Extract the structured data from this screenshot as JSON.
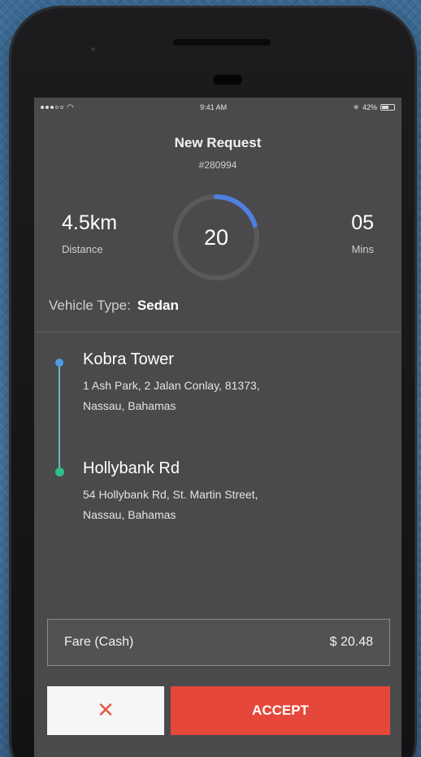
{
  "status_bar": {
    "time": "9:41 AM",
    "battery": "42%"
  },
  "header": {
    "title": "New Request",
    "request_id": "#280994"
  },
  "stats": {
    "distance_value": "4.5km",
    "distance_label": "Distance",
    "timer_value": "20",
    "timer_progress": 0.2,
    "mins_value": "05",
    "mins_label": "Mins"
  },
  "vehicle": {
    "label": "Vehicle Type:",
    "value": "Sedan"
  },
  "route": {
    "pickup": {
      "name": "Kobra Tower",
      "address_line1": "1 Ash Park, 2 Jalan Conlay, 81373,",
      "address_line2": "Nassau, Bahamas"
    },
    "dropoff": {
      "name": "Hollybank Rd",
      "address_line1": "54 Hollybank Rd, St. Martin Street,",
      "address_line2": "Nassau, Bahamas"
    }
  },
  "fare": {
    "label": "Fare (Cash)",
    "amount": "$ 20.48"
  },
  "actions": {
    "reject_symbol": "✕",
    "accept_label": "ACCEPT"
  },
  "colors": {
    "accent_blue": "#4f7fe0",
    "accept_red": "#e5473b",
    "dropoff_green": "#2fbf8a",
    "screen_bg": "#4a4a4c"
  },
  "icons": [
    "wifi-icon",
    "battery-icon",
    "bluetooth-icon",
    "close-icon"
  ]
}
